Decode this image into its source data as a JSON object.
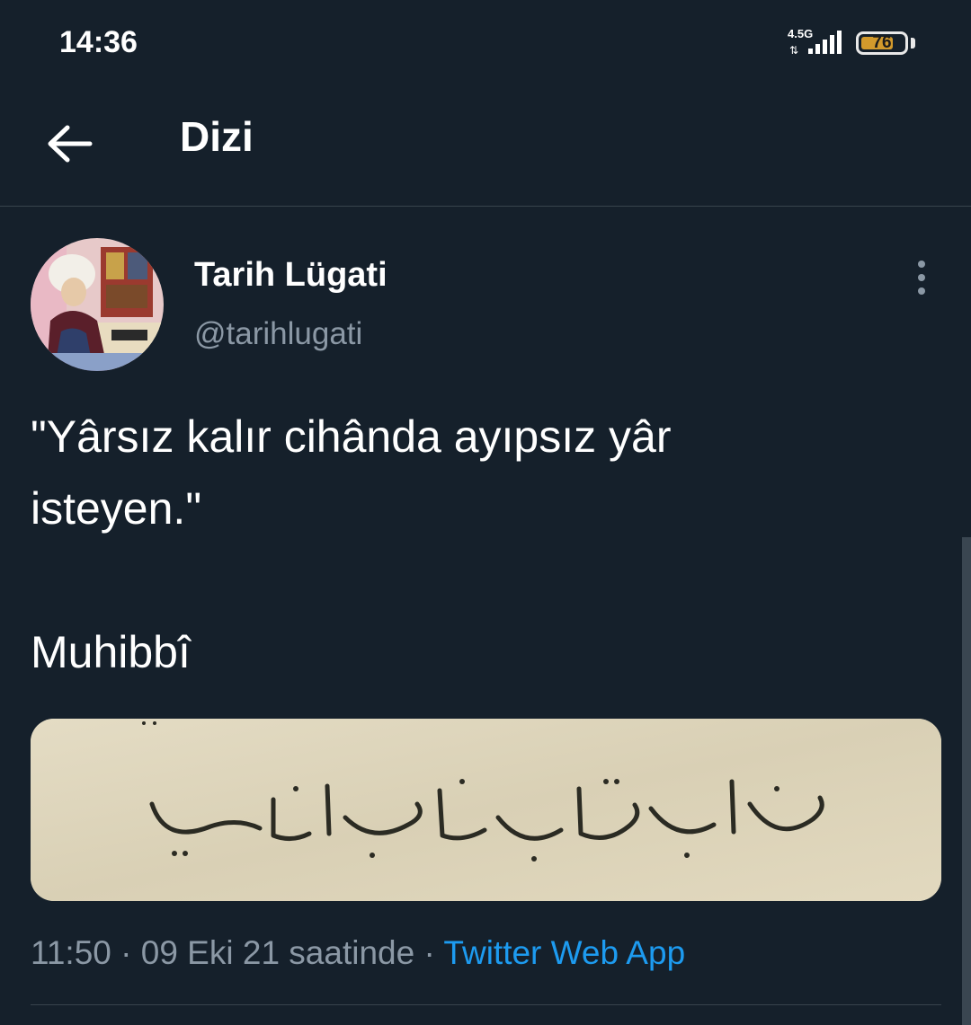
{
  "status_bar": {
    "time": "14:36",
    "network": "4.5G",
    "battery": "76",
    "battery_level": 0.76
  },
  "header": {
    "back_icon": "back-arrow-icon",
    "title": "Dizi"
  },
  "tweet": {
    "author": {
      "name": "Tarih Lügati",
      "handle": "@tarihlugati"
    },
    "more_icon": "more-vertical-icon",
    "text": "\"Yârsız kalır cihânda ayıpsız yâr\nisteyen.\"\n\nMuhibbî",
    "media_alt": "manuscript-line-image",
    "time": "11:50",
    "date": "09 Eki 21 saatinde",
    "separator": "·",
    "source": "Twitter Web App"
  },
  "colors": {
    "background": "#15202b",
    "secondary_text": "#8b98a5",
    "link": "#1d9bf0",
    "divider": "#38444d"
  }
}
